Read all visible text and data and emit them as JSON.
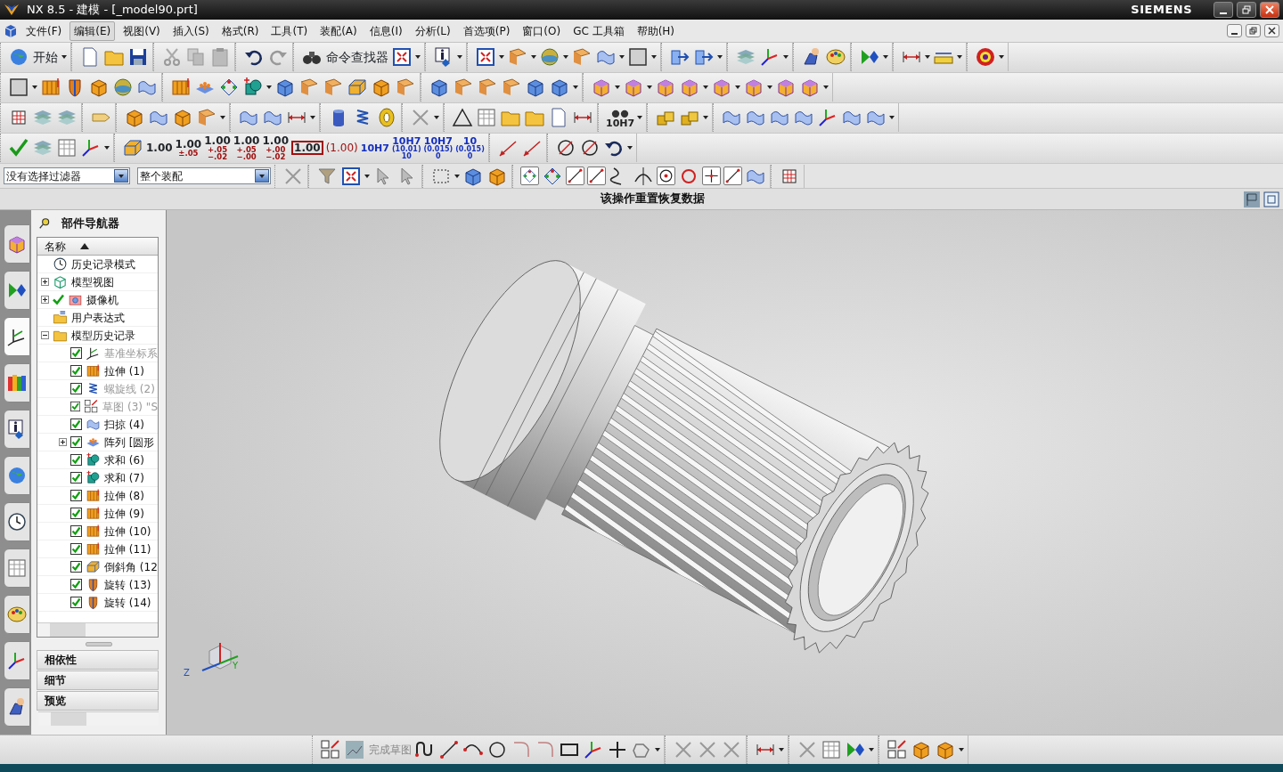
{
  "window": {
    "title": "NX 8.5 - 建模 - [_model90.prt]",
    "brand": "SIEMENS"
  },
  "menu": [
    {
      "label": "文件(F)",
      "selected": false
    },
    {
      "label": "编辑(E)",
      "selected": true
    },
    {
      "label": "视图(V)",
      "selected": false
    },
    {
      "label": "插入(S)",
      "selected": false
    },
    {
      "label": "格式(R)",
      "selected": false
    },
    {
      "label": "工具(T)",
      "selected": false
    },
    {
      "label": "装配(A)",
      "selected": false
    },
    {
      "label": "信息(I)",
      "selected": false
    },
    {
      "label": "分析(L)",
      "selected": false
    },
    {
      "label": "首选项(P)",
      "selected": false
    },
    {
      "label": "窗口(O)",
      "selected": false
    },
    {
      "label": "GC 工具箱",
      "selected": false
    },
    {
      "label": "帮助(H)",
      "selected": false
    }
  ],
  "toolbar": {
    "start": "开始",
    "command_finder": "命令查找器",
    "fit_finder_label": "10H7"
  },
  "dimension_styles": [
    {
      "kind": "plain",
      "lines": [
        "1.00"
      ]
    },
    {
      "kind": "tolerance",
      "lines": [
        "1.00",
        "±.05"
      ]
    },
    {
      "kind": "tolerance",
      "lines": [
        "1.00",
        "+.05",
        "−.02"
      ]
    },
    {
      "kind": "tolerance",
      "lines": [
        "1.00",
        "+.05",
        "−.00"
      ]
    },
    {
      "kind": "tolerance",
      "lines": [
        "1.00",
        "+.00",
        "−.02"
      ]
    },
    {
      "kind": "boxed",
      "lines": [
        "1.00"
      ]
    },
    {
      "kind": "reference",
      "lines": [
        "(1.00)"
      ]
    },
    {
      "kind": "fit",
      "lines": [
        "10H7"
      ]
    },
    {
      "kind": "fit",
      "lines": [
        "10H7",
        "(10.01)",
        "10"
      ]
    },
    {
      "kind": "fit",
      "lines": [
        "10H7",
        "(0.015)",
        "0"
      ]
    },
    {
      "kind": "fit",
      "lines": [
        "10",
        "(0.015)",
        "0"
      ]
    }
  ],
  "selection_bar": {
    "filter": "没有选择过滤器",
    "scope": "整个装配"
  },
  "status": "该操作重置恢复数据",
  "resource_bar": [
    {
      "selected": false
    },
    {
      "selected": false
    },
    {
      "selected": true
    },
    {
      "selected": false
    },
    {
      "selected": false
    },
    {
      "selected": false
    },
    {
      "selected": false
    },
    {
      "selected": false
    },
    {
      "selected": false
    },
    {
      "selected": false
    },
    {
      "selected": false
    }
  ],
  "navigator": {
    "title": "部件导航器",
    "column": "名称",
    "items": [
      {
        "label": "历史记录模式",
        "kind": "history",
        "checked": false,
        "expandable": false
      },
      {
        "label": "模型视图",
        "kind": "view",
        "checked": false,
        "expandable": true,
        "expanded": false
      },
      {
        "label": "摄像机",
        "kind": "camera",
        "checked": true,
        "expandable": true,
        "expanded": false
      },
      {
        "label": "用户表达式",
        "kind": "expressions",
        "checked": false,
        "expandable": false
      },
      {
        "label": "模型历史记录",
        "kind": "folder",
        "checked": false,
        "expandable": true,
        "expanded": true,
        "children": [
          {
            "label": "基准坐标系",
            "kind": "datum",
            "checked": true,
            "disabled": true,
            "expandable": false
          },
          {
            "label": "拉伸 (1)",
            "kind": "extrude",
            "checked": true,
            "disabled": false,
            "expandable": false
          },
          {
            "label": "螺旋线 (2)",
            "kind": "helix",
            "checked": true,
            "disabled": true,
            "expandable": false
          },
          {
            "label": "草图 (3) \"S",
            "kind": "sketch",
            "checked": true,
            "disabled": true,
            "expandable": false
          },
          {
            "label": "扫掠 (4)",
            "kind": "sweep",
            "checked": true,
            "disabled": false,
            "expandable": false
          },
          {
            "label": "阵列 [圆形",
            "kind": "pattern",
            "checked": true,
            "disabled": false,
            "expandable": true,
            "expanded": false
          },
          {
            "label": "求和 (6)",
            "kind": "unite",
            "checked": true,
            "disabled": false,
            "expandable": false
          },
          {
            "label": "求和 (7)",
            "kind": "unite",
            "checked": true,
            "disabled": false,
            "expandable": false
          },
          {
            "label": "拉伸 (8)",
            "kind": "extrude",
            "checked": true,
            "disabled": false,
            "expandable": false
          },
          {
            "label": "拉伸 (9)",
            "kind": "extrude",
            "checked": true,
            "disabled": false,
            "expandable": false
          },
          {
            "label": "拉伸 (10)",
            "kind": "extrude",
            "checked": true,
            "disabled": false,
            "expandable": false
          },
          {
            "label": "拉伸 (11)",
            "kind": "extrude",
            "checked": true,
            "disabled": false,
            "expandable": false
          },
          {
            "label": "倒斜角 (12",
            "kind": "chamfer",
            "checked": true,
            "disabled": false,
            "expandable": false
          },
          {
            "label": "旋转 (13)",
            "kind": "revolve",
            "checked": true,
            "disabled": false,
            "expandable": false
          },
          {
            "label": "旋转 (14)",
            "kind": "revolve",
            "checked": true,
            "disabled": false,
            "expandable": false
          }
        ]
      }
    ],
    "panels": [
      {
        "label": "相依性"
      },
      {
        "label": "细节"
      },
      {
        "label": "预览"
      }
    ]
  },
  "triad": {
    "labels": [
      "Z",
      "Y"
    ]
  },
  "sketch_toolbar": {
    "finish": "完成草图"
  }
}
